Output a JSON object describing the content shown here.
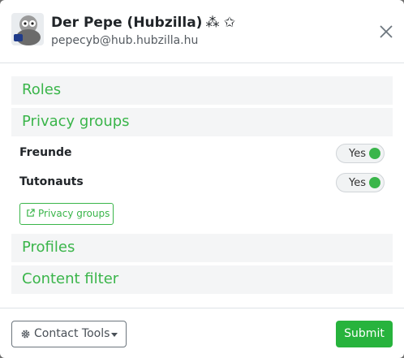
{
  "header": {
    "name": "Der Pepe (Hubzilla)",
    "glyphs": "⁂ ✩",
    "address": "pepecyb@hub.hubzilla.hu"
  },
  "sections": {
    "roles": "Roles",
    "privacy_groups": "Privacy groups",
    "profiles": "Profiles",
    "content_filter": "Content filter"
  },
  "groups": [
    {
      "name": "Freunde",
      "state": "Yes"
    },
    {
      "name": "Tutonauts",
      "state": "Yes"
    }
  ],
  "privacy_groups_link": "Privacy groups",
  "footer": {
    "tools_label": "Contact Tools",
    "submit_label": "Submit"
  },
  "colors": {
    "accent": "#3ab54a",
    "submit": "#27b33d"
  }
}
